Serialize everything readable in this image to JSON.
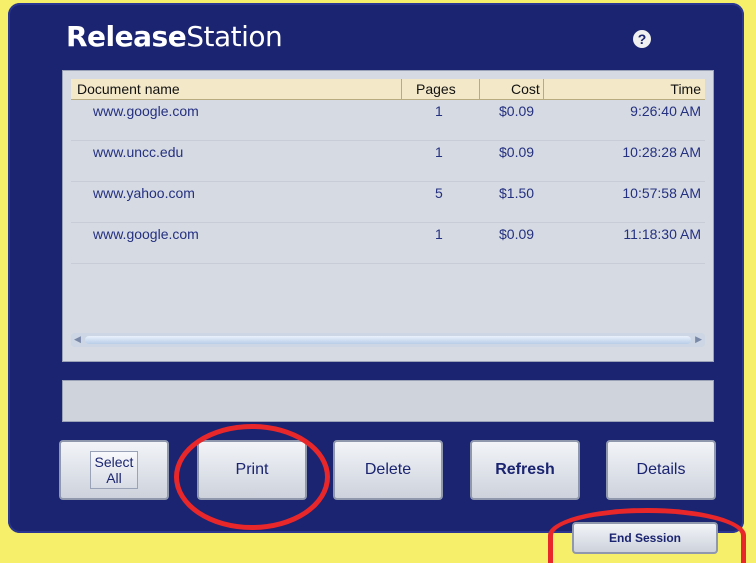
{
  "app": {
    "title_bold": "Release",
    "title_rest": "Station",
    "help_label": "?"
  },
  "table": {
    "columns": {
      "name": "Document name",
      "pages": "Pages",
      "cost": "Cost",
      "time": "Time"
    },
    "rows": [
      {
        "name": "www.google.com",
        "pages": "1",
        "cost": "$0.09",
        "time": "9:26:40 AM"
      },
      {
        "name": "www.uncc.edu",
        "pages": "1",
        "cost": "$0.09",
        "time": "10:28:28 AM"
      },
      {
        "name": "www.yahoo.com",
        "pages": "5",
        "cost": "$1.50",
        "time": "10:57:58 AM"
      },
      {
        "name": "www.google.com",
        "pages": "1",
        "cost": "$0.09",
        "time": "11:18:30 AM"
      }
    ]
  },
  "buttons": {
    "select_all_line1": "Select",
    "select_all_line2": "All",
    "print": "Print",
    "delete": "Delete",
    "refresh": "Refresh",
    "details": "Details",
    "end_session": "End Session"
  },
  "colors": {
    "frame": "#1a2470",
    "background": "#f5ef6a",
    "highlight_circle": "#e8272a"
  }
}
